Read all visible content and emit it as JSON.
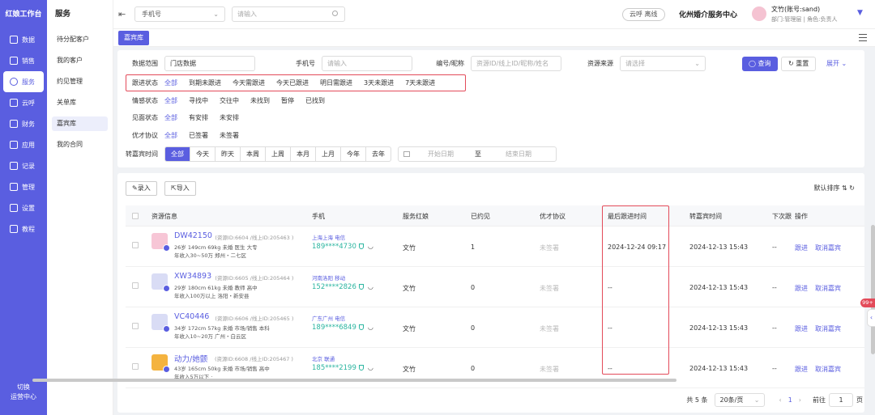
{
  "app": {
    "brand": "红娘工作台",
    "nav": [
      {
        "label": "数据",
        "icon": "chart-icon"
      },
      {
        "label": "销售",
        "icon": "cart-icon"
      },
      {
        "label": "服务",
        "icon": "heart-icon",
        "active": true
      },
      {
        "label": "云呼",
        "icon": "phone-icon"
      },
      {
        "label": "财务",
        "icon": "wallet-icon"
      },
      {
        "label": "应用",
        "icon": "grid-icon"
      },
      {
        "label": "记录",
        "icon": "doc-icon"
      },
      {
        "label": "管理",
        "icon": "manage-icon"
      },
      {
        "label": "设置",
        "icon": "gear-icon"
      },
      {
        "label": "教程",
        "icon": "book-icon"
      }
    ],
    "switch_label": "切换",
    "switch_label2": "运营中心"
  },
  "subnav": {
    "title": "服务",
    "items": [
      "待分配客户",
      "我的客户",
      "约见管理",
      "关单库",
      "嘉宾库",
      "我的合同"
    ],
    "active_index": 4
  },
  "topbar": {
    "search_type": "手机号",
    "search_placeholder": "请输入",
    "cloud_status": "云呼 离线",
    "center_name": "化州婚介服务中心",
    "user_name": "文竹(账号:sand)",
    "user_role": "部门:管理层 | 角色:负责人"
  },
  "tabs": [
    "嘉宾库"
  ],
  "filters": {
    "data_scope_label": "数据范围",
    "data_scope_value": "门店数据",
    "phone_label": "手机号",
    "phone_placeholder": "请输入",
    "code_label": "编号/昵称",
    "code_placeholder": "资源ID/线上ID/昵称/姓名",
    "source_label": "资源来源",
    "source_placeholder": "请选择",
    "query_button": "查询",
    "reset_button": "重置",
    "expand_link": "展开",
    "follow_label": "跟进状态",
    "follow_options": [
      "全部",
      "到期未跟进",
      "今天需跟进",
      "今天已跟进",
      "明日需跟进",
      "3天未跟进",
      "7天未跟进"
    ],
    "emotion_label": "情感状态",
    "emotion_options": [
      "全部",
      "寻找中",
      "交往中",
      "未找到",
      "暂停",
      "已找到"
    ],
    "meet_label": "见面状态",
    "meet_options": [
      "全部",
      "有安排",
      "未安排"
    ],
    "talent_label": "优才协议",
    "talent_options": [
      "全部",
      "已签署",
      "未签署"
    ],
    "time_label": "转嘉宾时间",
    "time_options": [
      "全部",
      "今天",
      "昨天",
      "本周",
      "上周",
      "本月",
      "上月",
      "今年",
      "去年"
    ],
    "date_start": "开始日期",
    "date_sep": "至",
    "date_end": "结束日期"
  },
  "toolbar": {
    "enter_button": "录入",
    "import_button": "导入",
    "sort_label": "默认排序"
  },
  "table": {
    "headers": {
      "info": "资源信息",
      "phone": "手机",
      "matchmaker": "服务红娘",
      "met": "已约见",
      "talent": "优才协议",
      "last_follow": "最后跟进时间",
      "to_guest": "转嘉宾时间",
      "next": "下次跟",
      "ops": "操作"
    },
    "rows": [
      {
        "name": "DW42150",
        "ids": "(资源ID:6604 /线上ID:205463 )",
        "line2": "26岁  149cm  69kg  未婚  医生  大专",
        "line3": "年收入30~50万  郑州・二七区",
        "location": "上海上海 电信",
        "phone": "189****4730",
        "matchmaker": "文竹",
        "met": "1",
        "talent": "未签署",
        "last_follow": "2024-12-24 09:17",
        "to_guest": "2024-12-13 15:43",
        "next": "--",
        "op1": "跟进",
        "op2": "取消嘉宾",
        "avatar_color": "#f7c6d6"
      },
      {
        "name": "XW34893",
        "ids": "(资源ID:6605 /线上ID:205464 )",
        "line2": "29岁  180cm  61kg  未婚  教师  高中",
        "line3": "年收入100万以上  洛阳・新安县",
        "location": "河南洛阳 移动",
        "phone": "152****2826",
        "matchmaker": "文竹",
        "met": "0",
        "talent": "未签署",
        "last_follow": "--",
        "to_guest": "2024-12-13 15:43",
        "next": "--",
        "op1": "跟进",
        "op2": "取消嘉宾",
        "avatar_color": "#d9dcf5"
      },
      {
        "name": "VC40446",
        "ids": "(资源ID:6606 /线上ID:205465 )",
        "line2": "34岁  172cm  57kg  未婚  市场/销售  本科",
        "line3": "年收入10~20万  广州・白云区",
        "location": "广东广州 电信",
        "phone": "189****6849",
        "matchmaker": "文竹",
        "met": "0",
        "talent": "未签署",
        "last_follow": "--",
        "to_guest": "2024-12-13 15:43",
        "next": "--",
        "op1": "跟进",
        "op2": "取消嘉宾",
        "avatar_color": "#d9dcf5"
      },
      {
        "name": "动力/她颤",
        "ids": "(资源ID:6608 /线上ID:205467 )",
        "line2": "43岁  165cm  50kg  未婚  市场/销售  高中",
        "line3": "年收入5万以下  ·",
        "location": "北京 联通",
        "phone": "185****2199",
        "matchmaker": "文竹",
        "met": "0",
        "talent": "未签署",
        "last_follow": "--",
        "to_guest": "2024-12-13 15:43",
        "next": "--",
        "op1": "跟进",
        "op2": "取消嘉宾",
        "avatar_color": "#f4b33f"
      }
    ]
  },
  "pager": {
    "total": "共 5 条",
    "page_size": "20条/页",
    "current": "1",
    "goto_label": "前往",
    "goto_value": "1",
    "page_suffix": "页"
  },
  "float_badge": "99+"
}
